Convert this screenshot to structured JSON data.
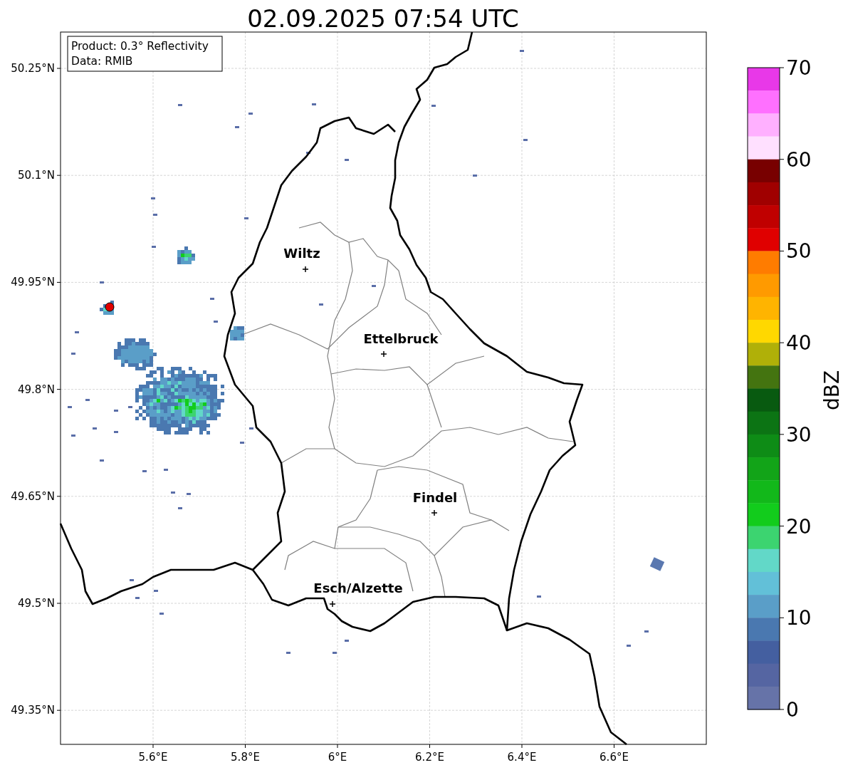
{
  "title": "02.09.2025 07:54 UTC",
  "info": [
    "Product: 0.3° Reflectivity",
    "Data: RMIB"
  ],
  "x_ticks": [
    "5.6°E",
    "5.8°E",
    "6°E",
    "6.2°E",
    "6.4°E",
    "6.6°E"
  ],
  "y_ticks": [
    "50.25°N",
    "50.1°N",
    "49.95°N",
    "49.8°N",
    "49.65°N",
    "49.5°N",
    "49.35°N"
  ],
  "cities": [
    {
      "name": "Wiltz"
    },
    {
      "name": "Ettelbruck"
    },
    {
      "name": "Findel"
    },
    {
      "name": "Esch/Alzette"
    }
  ],
  "colorbar": {
    "label": "dBZ",
    "ticks": [
      "70",
      "60",
      "50",
      "40",
      "30",
      "20",
      "10",
      "0"
    ],
    "bins": [
      {
        "color": "#e838e8"
      },
      {
        "color": "#ff70ff"
      },
      {
        "color": "#ffb0ff"
      },
      {
        "color": "#ffe0ff"
      },
      {
        "color": "#780000"
      },
      {
        "color": "#a00000"
      },
      {
        "color": "#c00000"
      },
      {
        "color": "#e00000"
      },
      {
        "color": "#ff7c00"
      },
      {
        "color": "#ff9a00"
      },
      {
        "color": "#ffb400"
      },
      {
        "color": "#ffd800"
      },
      {
        "color": "#b0b008"
      },
      {
        "color": "#447410"
      },
      {
        "color": "#085a10"
      },
      {
        "color": "#0c7414"
      },
      {
        "color": "#0e8c16"
      },
      {
        "color": "#12a418"
      },
      {
        "color": "#12b81a"
      },
      {
        "color": "#12cc1c"
      },
      {
        "color": "#3cd470"
      },
      {
        "color": "#62d8c8"
      },
      {
        "color": "#62c0d8"
      },
      {
        "color": "#5a9ec8"
      },
      {
        "color": "#4a78b0"
      },
      {
        "color": "#445fa0"
      },
      {
        "color": "#5565a2"
      },
      {
        "color": "#6673a8"
      }
    ]
  }
}
